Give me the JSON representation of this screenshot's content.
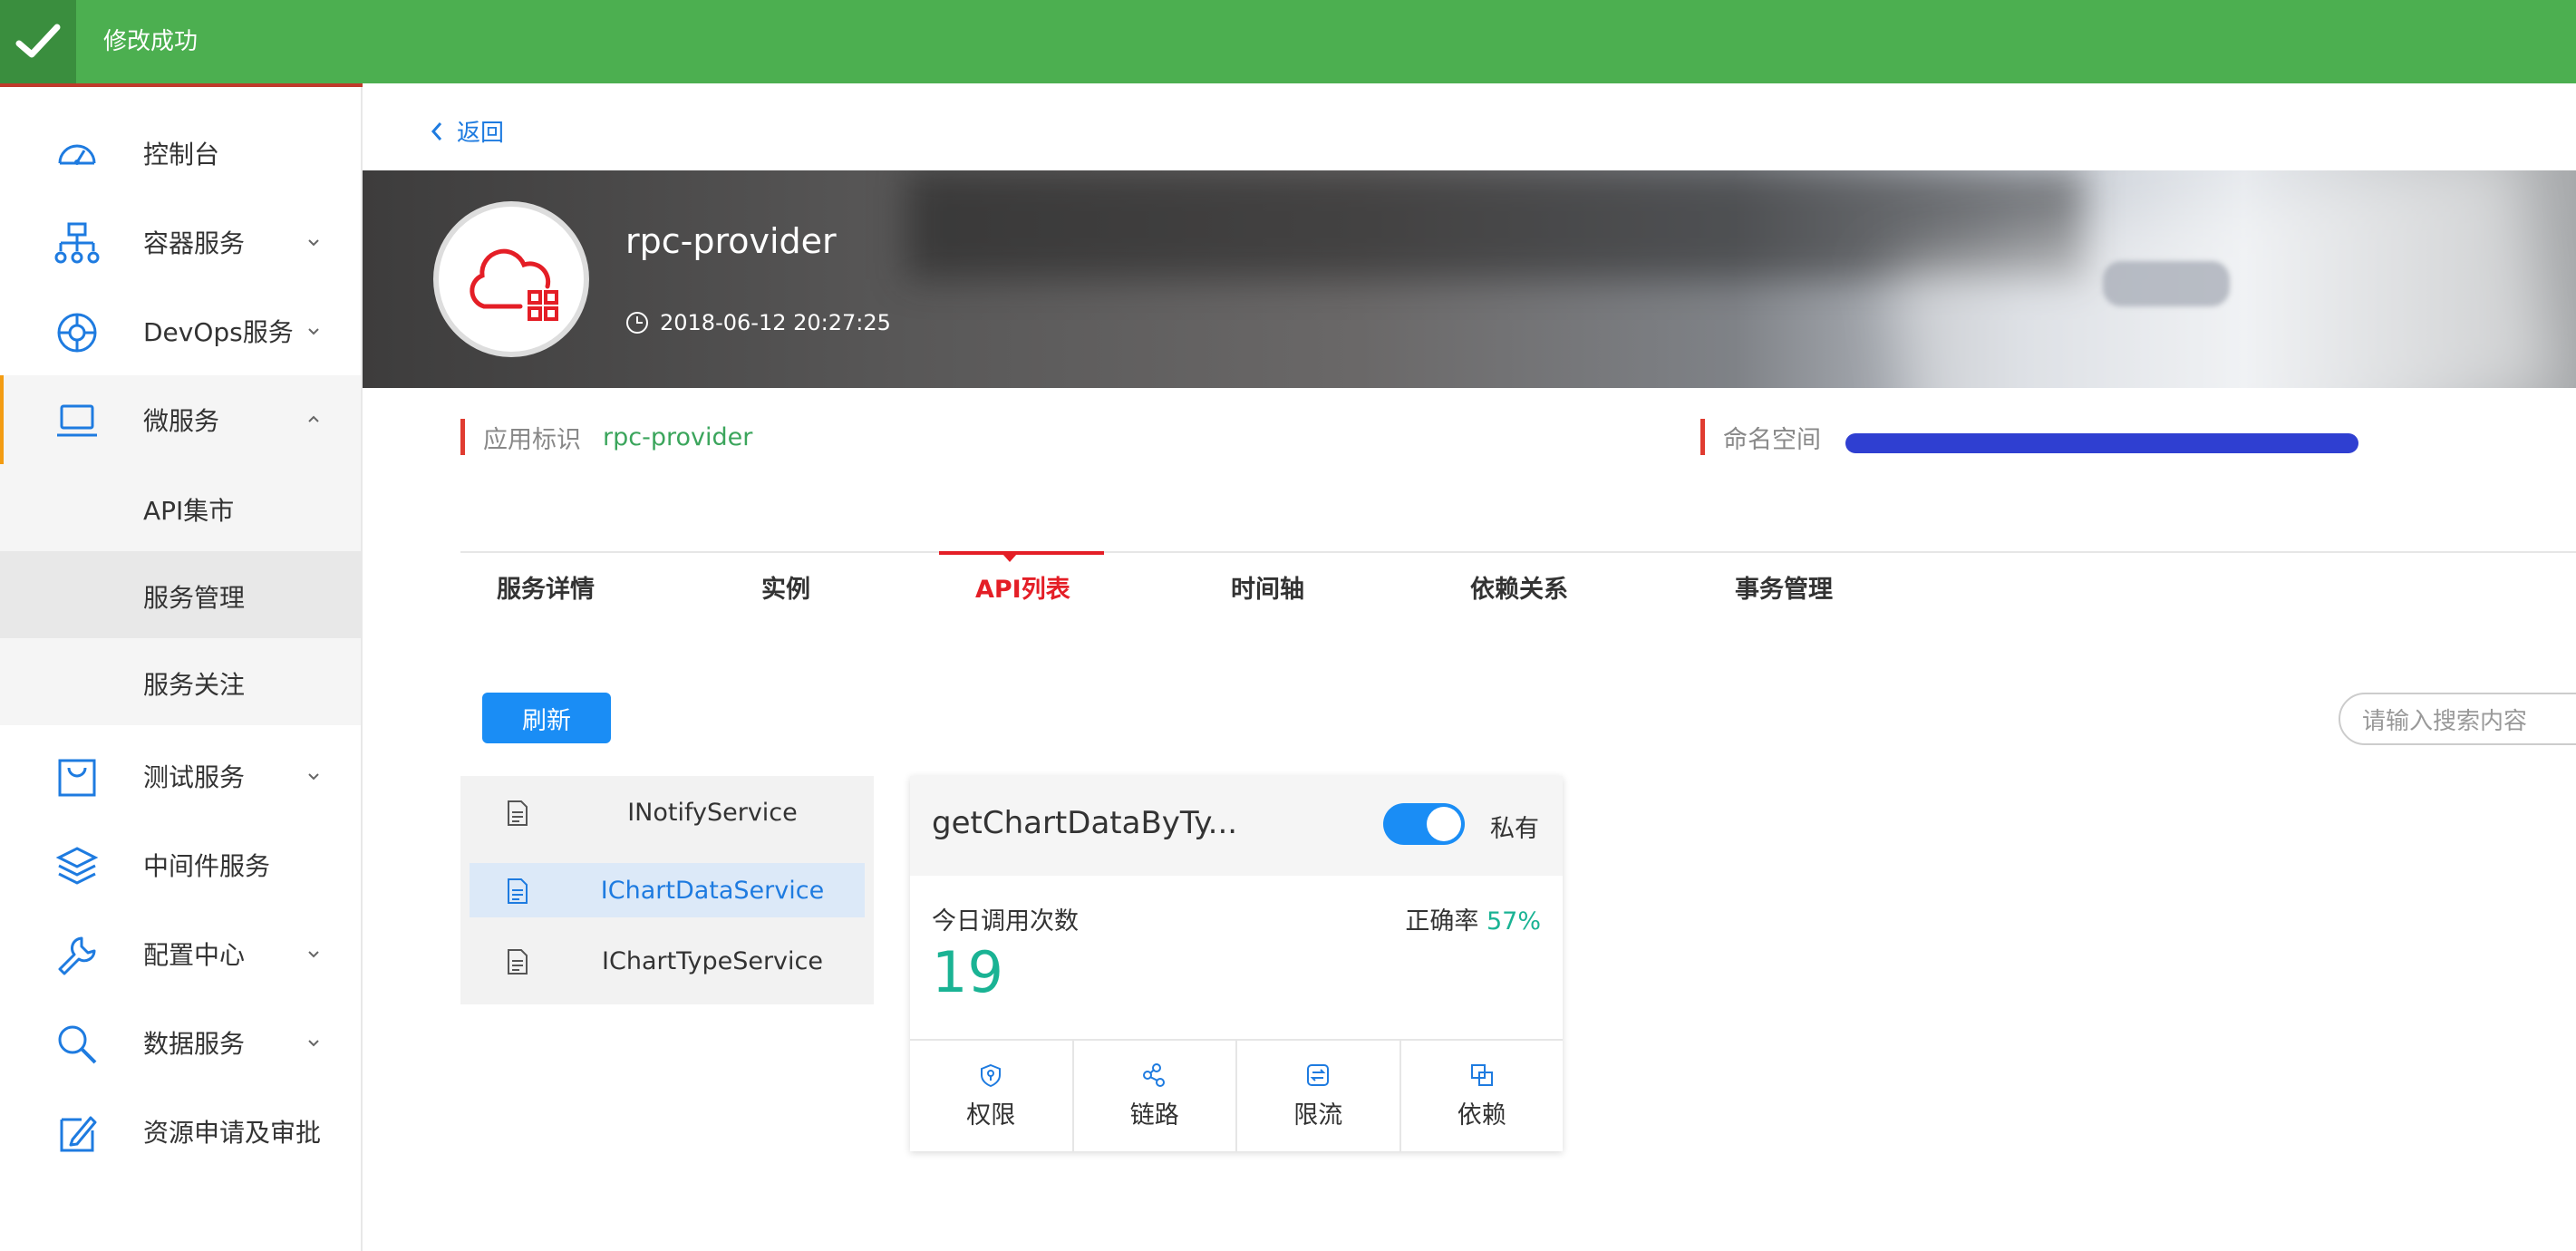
{
  "toast": {
    "message": "修改成功"
  },
  "sidebar": {
    "items": [
      {
        "label": "控制台",
        "icon": "dashboard-icon"
      },
      {
        "label": "容器服务",
        "icon": "container-icon"
      },
      {
        "label": "DevOps服务",
        "icon": "devops-icon"
      },
      {
        "label": "微服务",
        "icon": "laptop-icon"
      },
      {
        "label": "测试服务",
        "icon": "bag-icon"
      },
      {
        "label": "中间件服务",
        "icon": "layers-icon"
      },
      {
        "label": "配置中心",
        "icon": "wrench-icon"
      },
      {
        "label": "数据服务",
        "icon": "search-icon"
      },
      {
        "label": "资源申请及审批",
        "icon": "edit-icon"
      }
    ],
    "sub_items": [
      {
        "label": "API集市"
      },
      {
        "label": "服务管理"
      },
      {
        "label": "服务关注"
      }
    ]
  },
  "header": {
    "back_label": "返回",
    "app_name": "rpc-provider",
    "created_time": "2018-06-12 20:27:25"
  },
  "meta": {
    "app_id_label": "应用标识",
    "app_id_value": "rpc-provider",
    "namespace_label": "命名空间"
  },
  "tabs": [
    {
      "label": "服务详情"
    },
    {
      "label": "实例"
    },
    {
      "label": "API列表"
    },
    {
      "label": "时间轴"
    },
    {
      "label": "依赖关系"
    },
    {
      "label": "事务管理"
    }
  ],
  "toolbar": {
    "refresh_label": "刷新",
    "search_placeholder": "请输入搜索内容"
  },
  "services": [
    {
      "name": "INotifyService"
    },
    {
      "name": "IChartDataService"
    },
    {
      "name": "IChartTypeService"
    }
  ],
  "api_card": {
    "title": "getChartDataByTy...",
    "visibility_label": "私有",
    "private_enabled": true,
    "calls_label": "今日调用次数",
    "calls_value": "19",
    "accuracy_label": "正确率",
    "accuracy_value": "57%",
    "actions": [
      {
        "label": "权限",
        "icon": "shield-icon"
      },
      {
        "label": "链路",
        "icon": "link-icon"
      },
      {
        "label": "限流",
        "icon": "throttle-icon"
      },
      {
        "label": "依赖",
        "icon": "dependency-icon"
      }
    ]
  },
  "colors": {
    "toast_green": "#4caf50",
    "accent_red": "#e41e26",
    "primary_blue": "#1a8df5",
    "success_teal": "#1ab394"
  }
}
